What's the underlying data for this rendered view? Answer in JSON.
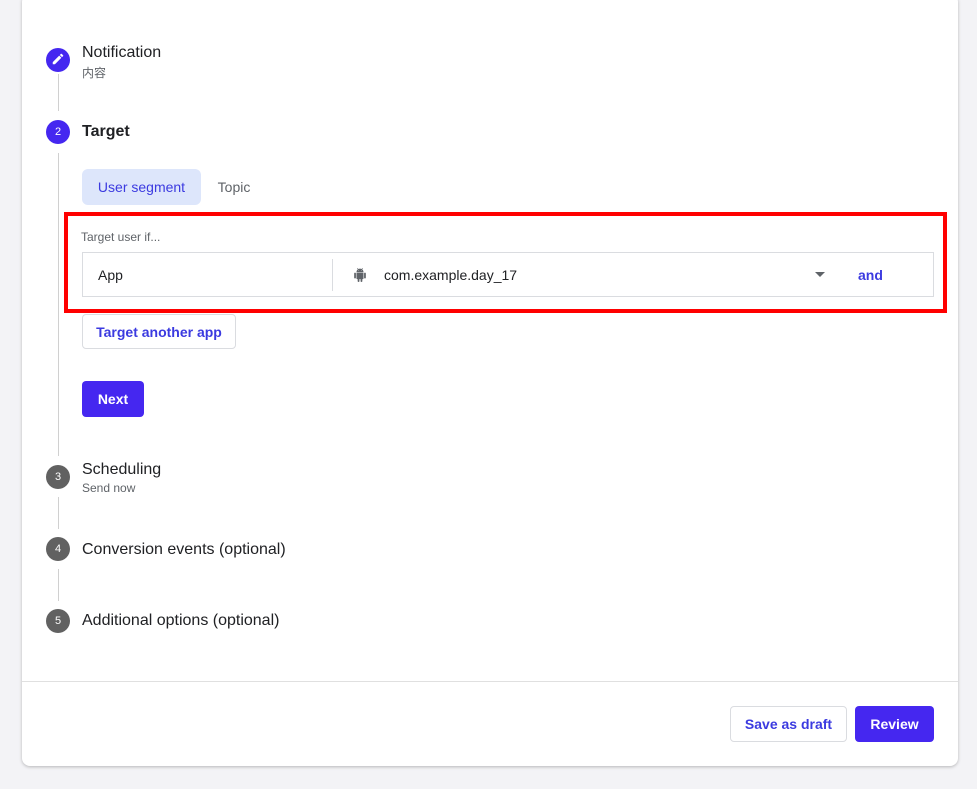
{
  "steps": [
    {
      "number": "",
      "title": "Notification",
      "subtitle": "内容",
      "state": "completed",
      "icon": "pencil-icon"
    },
    {
      "number": "2",
      "title": "Target",
      "subtitle": "",
      "state": "active"
    },
    {
      "number": "3",
      "title": "Scheduling",
      "subtitle": "Send now",
      "state": "pending"
    },
    {
      "number": "4",
      "title": "Conversion events (optional)",
      "subtitle": "",
      "state": "pending"
    },
    {
      "number": "5",
      "title": "Additional options (optional)",
      "subtitle": "",
      "state": "pending"
    }
  ],
  "target": {
    "tabs": [
      {
        "label": "User segment",
        "selected": true
      },
      {
        "label": "Topic",
        "selected": false
      }
    ],
    "condition_label": "Target user if...",
    "row": {
      "field": "App",
      "platform_icon": "android-icon",
      "value": "com.example.day_17",
      "connector": "and"
    },
    "add_app_label": "Target another app",
    "next_label": "Next"
  },
  "footer": {
    "save_draft_label": "Save as draft",
    "review_label": "Review"
  },
  "colors": {
    "accent": "#4527f0",
    "link": "#3b3ae0",
    "highlight": "#ff0000",
    "tab_selected_bg": "#dde6fb",
    "inactive_step": "#616161"
  }
}
